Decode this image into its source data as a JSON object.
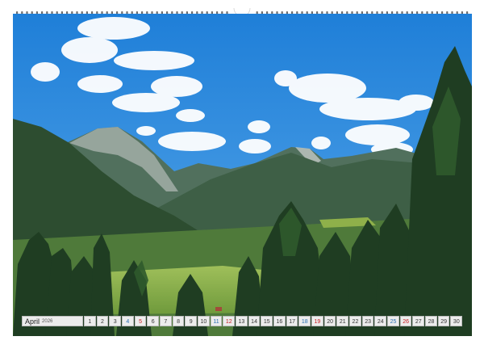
{
  "calendar": {
    "month": "April",
    "year": "2026",
    "days": [
      "1",
      "2",
      "3",
      "4",
      "5",
      "6",
      "7",
      "8",
      "9",
      "10",
      "11",
      "12",
      "13",
      "14",
      "15",
      "16",
      "17",
      "18",
      "19",
      "20",
      "21",
      "22",
      "23",
      "24",
      "25",
      "26",
      "27",
      "28",
      "29",
      "30"
    ],
    "saturday_days": [
      "4",
      "11",
      "18",
      "25"
    ],
    "sunday_days": [
      "5",
      "12",
      "19",
      "26"
    ],
    "accent_colors": {
      "saturday": "#2a6fb3",
      "sunday": "#c8191e"
    }
  },
  "photo": {
    "subject": "alpine-valley-landscape",
    "colors": {
      "sky": "#2f8fe0",
      "mountain": "#3d5b4a",
      "forest": "#274a2a",
      "meadow": "#8fb04a"
    }
  }
}
